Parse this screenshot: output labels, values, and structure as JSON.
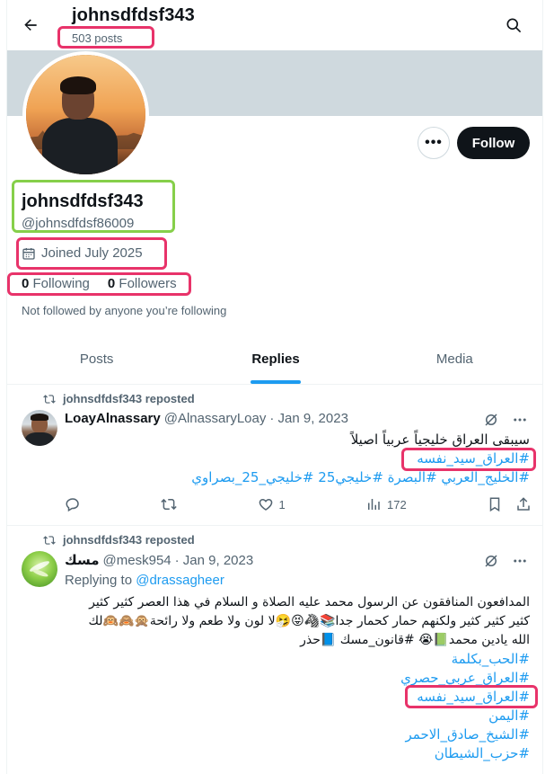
{
  "header": {
    "name": "johnsdfdsf343",
    "posts_count": "503 posts"
  },
  "profile": {
    "display_name": "johnsdfdsf343",
    "handle": "@johnsdfdsf86009",
    "joined": "Joined July 2025",
    "following_count": "0",
    "following_label": "Following",
    "followers_count": "0",
    "followers_label": "Followers",
    "not_followed": "Not followed by anyone you’re following",
    "follow_label": "Follow",
    "more_label": "•••"
  },
  "tabs": [
    {
      "label": "Posts"
    },
    {
      "label": "Replies"
    },
    {
      "label": "Media"
    }
  ],
  "posts": [
    {
      "repost_label": "johnsdfdsf343 reposted",
      "name": "LoayAlnassary",
      "handle": "@AlnassaryLoay",
      "date": "· Jan 9, 2023",
      "text_line1": "سيبقى العراق خليجياً عربياً اصيلاً",
      "tag1": "#العراق_سيد_نفسه",
      "tags_line": "#الخليج_العربي #البصرة #خليجي25 #خليجي_25_بصراوي",
      "likes": "1",
      "views": "172"
    },
    {
      "repost_label": "johnsdfdsf343 reposted",
      "name": "مسك",
      "handle": "@mesk954",
      "date": "· Jan 9, 2023",
      "replying_prefix": "Replying to",
      "replying_to": "@drassagheer",
      "body1": "المدافعون المنافقون عن الرسول محمد عليه الصلاة و السلام في هذا العصر كثير كثير",
      "body2": "كثير كثير كثير ولكنهم حمار كحمار جدا📚🦓😝🤧لا لون ولا طعم ولا رائحة🙊🙈🙉لك",
      "body3": "الله يادين محمد📗😭 #قانون_مسك 📘حذر",
      "tags": [
        "#الحب_بكلمة",
        "#العراق_عربي_حصري",
        "#العراق_سيد_نفسه",
        "#اليمن",
        "#الشيخ_صادق_الاحمر",
        "#حزب_الشيطان"
      ]
    }
  ],
  "colors": {
    "accent": "#1d9bf0",
    "highlight_pink": "#e8336a",
    "highlight_green": "#86cf4a",
    "text": "#0f1419",
    "muted": "#536471"
  }
}
